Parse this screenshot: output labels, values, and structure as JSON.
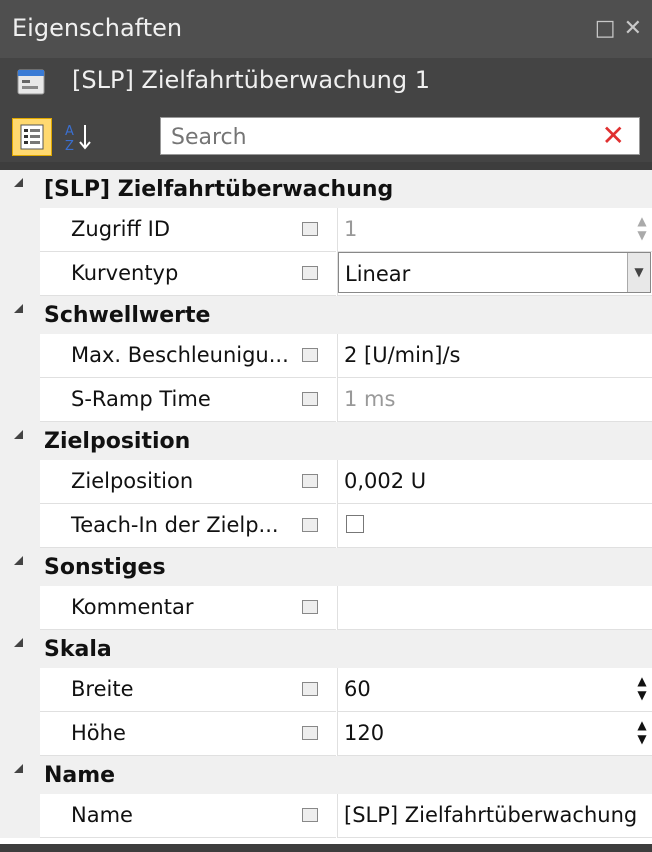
{
  "window": {
    "title": "Eigenschaften"
  },
  "object": {
    "name": "[SLP] Zielfahrtüberwachung 1"
  },
  "search": {
    "placeholder": "Search"
  },
  "categories": [
    {
      "name": "[SLP] Zielfahrtüberwachung",
      "properties": [
        {
          "label": "Zugriff ID",
          "value": "1"
        },
        {
          "label": "Kurventyp",
          "value": "Linear"
        }
      ]
    },
    {
      "name": "Schwellwerte",
      "properties": [
        {
          "label": "Max. Beschleunigu...",
          "value": "2 [U/min]/s"
        },
        {
          "label": "S-Ramp Time",
          "value": "1 ms"
        }
      ]
    },
    {
      "name": "Zielposition",
      "properties": [
        {
          "label": "Zielposition",
          "value": "0,002 U"
        },
        {
          "label": "Teach-In der Zielp...",
          "value": ""
        }
      ]
    },
    {
      "name": "Sonstiges",
      "properties": [
        {
          "label": "Kommentar",
          "value": ""
        }
      ]
    },
    {
      "name": "Skala",
      "properties": [
        {
          "label": "Breite",
          "value": "60"
        },
        {
          "label": "Höhe",
          "value": "120"
        }
      ]
    },
    {
      "name": "Name",
      "properties": [
        {
          "label": "Name",
          "value": "[SLP] Zielfahrtüberwachung"
        }
      ]
    }
  ]
}
